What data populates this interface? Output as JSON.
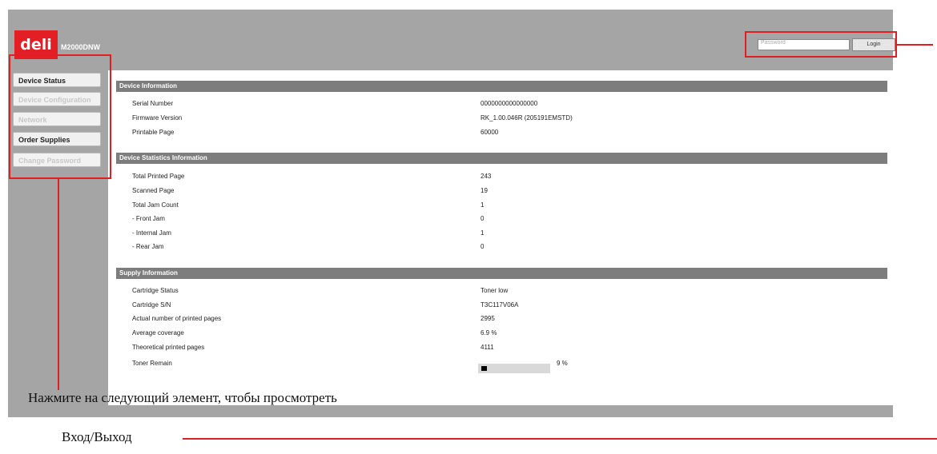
{
  "header": {
    "logo_text": "deli",
    "model": "M2000DNW",
    "password_placeholder": "Password",
    "login_label": "Login"
  },
  "sidebar": {
    "items": [
      {
        "label": "Device Status",
        "state": "active"
      },
      {
        "label": "Device Configuration",
        "state": "disabled"
      },
      {
        "label": "Network",
        "state": "disabled"
      },
      {
        "label": "Order Supplies",
        "state": "active"
      },
      {
        "label": "Change Password",
        "state": "disabled"
      }
    ]
  },
  "device_info": {
    "title": "Device Information",
    "rows": [
      {
        "label": "Serial Number",
        "value": "0000000000000000"
      },
      {
        "label": "Firmware Version",
        "value": "RK_1.00.046R (205191EMSTD)"
      },
      {
        "label": "Printable Page",
        "value": "60000"
      }
    ]
  },
  "stats_info": {
    "title": "Device Statistics Information",
    "rows": [
      {
        "label": "Total Printed Page",
        "value": "243"
      },
      {
        "label": "Scanned Page",
        "value": "19"
      },
      {
        "label": "Total Jam Count",
        "value": "1"
      },
      {
        "label": "- Front Jam",
        "value": "0"
      },
      {
        "label": "- Internal Jam",
        "value": "1"
      },
      {
        "label": "- Rear Jam",
        "value": "0"
      }
    ]
  },
  "supply_info": {
    "title": "Supply Information",
    "rows": [
      {
        "label": "Cartridge Status",
        "value": "Toner low"
      },
      {
        "label": "Cartridge S/N",
        "value": "T3C117V06A"
      },
      {
        "label": "Actual number of printed pages",
        "value": "2995"
      },
      {
        "label": "Average coverage",
        "value": "6.9 %"
      },
      {
        "label": "Theoretical printed pages",
        "value": "4111"
      }
    ],
    "toner_label": "Toner Remain",
    "toner_percent_text": "9 %",
    "toner_fraction": 0.09
  },
  "annotations": {
    "caption_nav": "Нажмите на следующий элемент, чтобы просмотреть",
    "caption_login": "Вход/Выход",
    "highlight_color": "#e02020"
  }
}
